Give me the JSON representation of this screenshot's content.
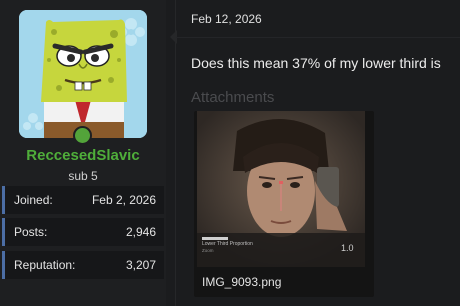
{
  "user": {
    "username": "ReccesedSlavic",
    "user_title": "sub 5",
    "stats": [
      {
        "label": "Joined:",
        "value": "Feb 2, 2026"
      },
      {
        "label": "Posts:",
        "value": "2,946"
      },
      {
        "label": "Reputation:",
        "value": "3,207"
      }
    ]
  },
  "post": {
    "date": "Feb 12, 2026",
    "text": "Does this mean 37% of my lower third is",
    "attachments_label": "Attachments",
    "attachment": {
      "file_name": "IMG_9093.png",
      "thumbnail_caption": "Lower Third Proportion",
      "thumbnail_sub": "Zoom",
      "thumbnail_value": "1.0"
    }
  },
  "colors": {
    "username": "#4fae3a",
    "status_online": "#53a43a",
    "stat_accent": "#4c6ea5"
  }
}
